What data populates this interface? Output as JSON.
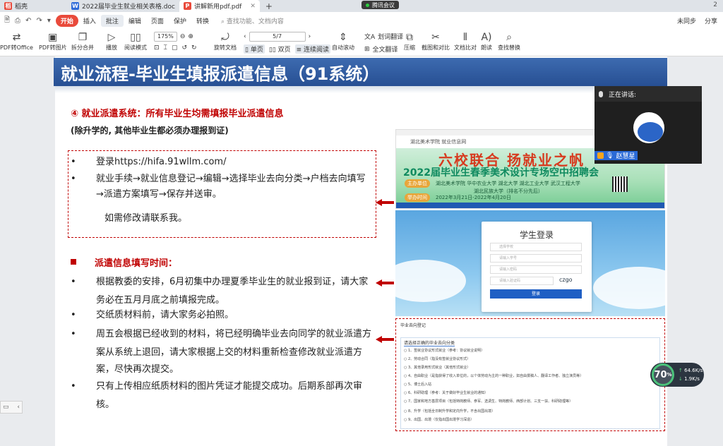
{
  "tabs": {
    "home": "稻壳",
    "doc_tab": "2022届毕业生就业相关表格.doc",
    "pdf_tab": "讲解新用pdf.pdf",
    "meeting": "腾讯会议",
    "right_badge": "2"
  },
  "menu": {
    "items": [
      "开始",
      "插入",
      "批注",
      "编辑",
      "页面",
      "保护",
      "转换"
    ],
    "search": "查找功能、文档内容",
    "sync": "未同步",
    "share": "分享"
  },
  "ribbon": {
    "pdf_to_office": "PDF转Office",
    "pdf_to_image": "PDF转图片",
    "split_merge": "拆分合并",
    "play": "播放",
    "read_mode": "阅读模式",
    "zoom": "175%",
    "page": "5/7",
    "rotate": "旋转文档",
    "single": "单页",
    "double": "双页",
    "continuous": "连续阅读",
    "auto_scroll": "自动滚动",
    "translate": "划词翻译",
    "full_translate": "全文翻译",
    "compress": "压缩",
    "screenshot_compare": "截图和对比",
    "doc_compare": "文档比对",
    "read_aloud": "朗读",
    "find_replace": "查找替换"
  },
  "slide": {
    "title": "就业流程-毕业生填报派遣信息（91系统）",
    "red_heading": "④ 就业派遣系统：所有毕业生均需填报毕业派遣信息",
    "sub_heading": "(除升学的, 其他毕业生都必须办理报到证)",
    "box_bullets": [
      "登录https://hifa.91wllm.com/",
      "就业手续→就业信息登记→编辑→选择毕业去向分类→户档去向填写",
      "→派遣方案填写→保存并送审。"
    ],
    "box_note": "如需修改请联系我。",
    "time_heading": "派遣信息填写时间：",
    "time_bullets": [
      [
        "根据教委的安排，6月初集中办理夏季毕业生的就业报到证，请大家",
        "务必在五月月底之前填报完成。"
      ],
      [
        "交纸质材料前，请大家务必拍照。"
      ],
      [
        "周五会根据已经收到的材料，将已经明确毕业去向同学的就业派遣方",
        "案从系统上退回，请大家根据上交的材料重新检查修改就业派遣方",
        "案，尽快再次提交。"
      ],
      [
        "只有上传相应纸质材料的图片凭证才能提交成功。后期系部再次审",
        "核。"
      ]
    ]
  },
  "shot1": {
    "logo": "湖北美术学院 就业信息网",
    "big": "六校联合 扬就业之帆",
    "mid": "2022届毕业生春季美术设计专场空中招聘会",
    "tag1": "主办单位",
    "tag2": "举办时间",
    "info1": "湖北美术学院 华中农业大学 湖北大学 湖北工业大学 武汉工程大学",
    "info2": "湖北民族大学（排名不分先后）",
    "info3": "2022年3月21日-2022年4月20日"
  },
  "shot2": {
    "title": "学生登录",
    "fields": [
      "选择学校",
      "请输入学号",
      "请输入密码",
      "请输入验证码"
    ],
    "captcha": "czgo",
    "button": "登录"
  },
  "shot3": {
    "header": "毕业去向登记",
    "select_head": "请选择正确的毕业去向分类",
    "options": [
      "○ 1、签就业协议形式就业（参考：协议就业说明）",
      "○ 2、劳动合同（指没有签就业协议形式）",
      "○ 3、其他录用形式就业（其他形式就业）",
      "○ 4、自由职业（是指获得了收入单位的，以个体劳动为主的一种职业，如自由撰稿人、翻译工作者、独立演员等）",
      "○ 5、博士后入站",
      "○ 6、科研助理（参考：关于做好毕业生就业的通知）",
      "○ 7、国家和地方基层项目（包括特岗教师、参军、选调生、特岗教师、西部计划、三支一扶、科研助理等）",
      "○ 8、升学（包括全日制升学和定向升学，不含出国出境）",
      "○ 9、出国、出境（仅指出国出境学习深造）"
    ]
  },
  "video": {
    "speaking": "正在讲话:",
    "name": "赵慧星"
  },
  "speed": {
    "percent": "70",
    "up": "64.6",
    "down": "1.9",
    "unit": "K/s"
  }
}
